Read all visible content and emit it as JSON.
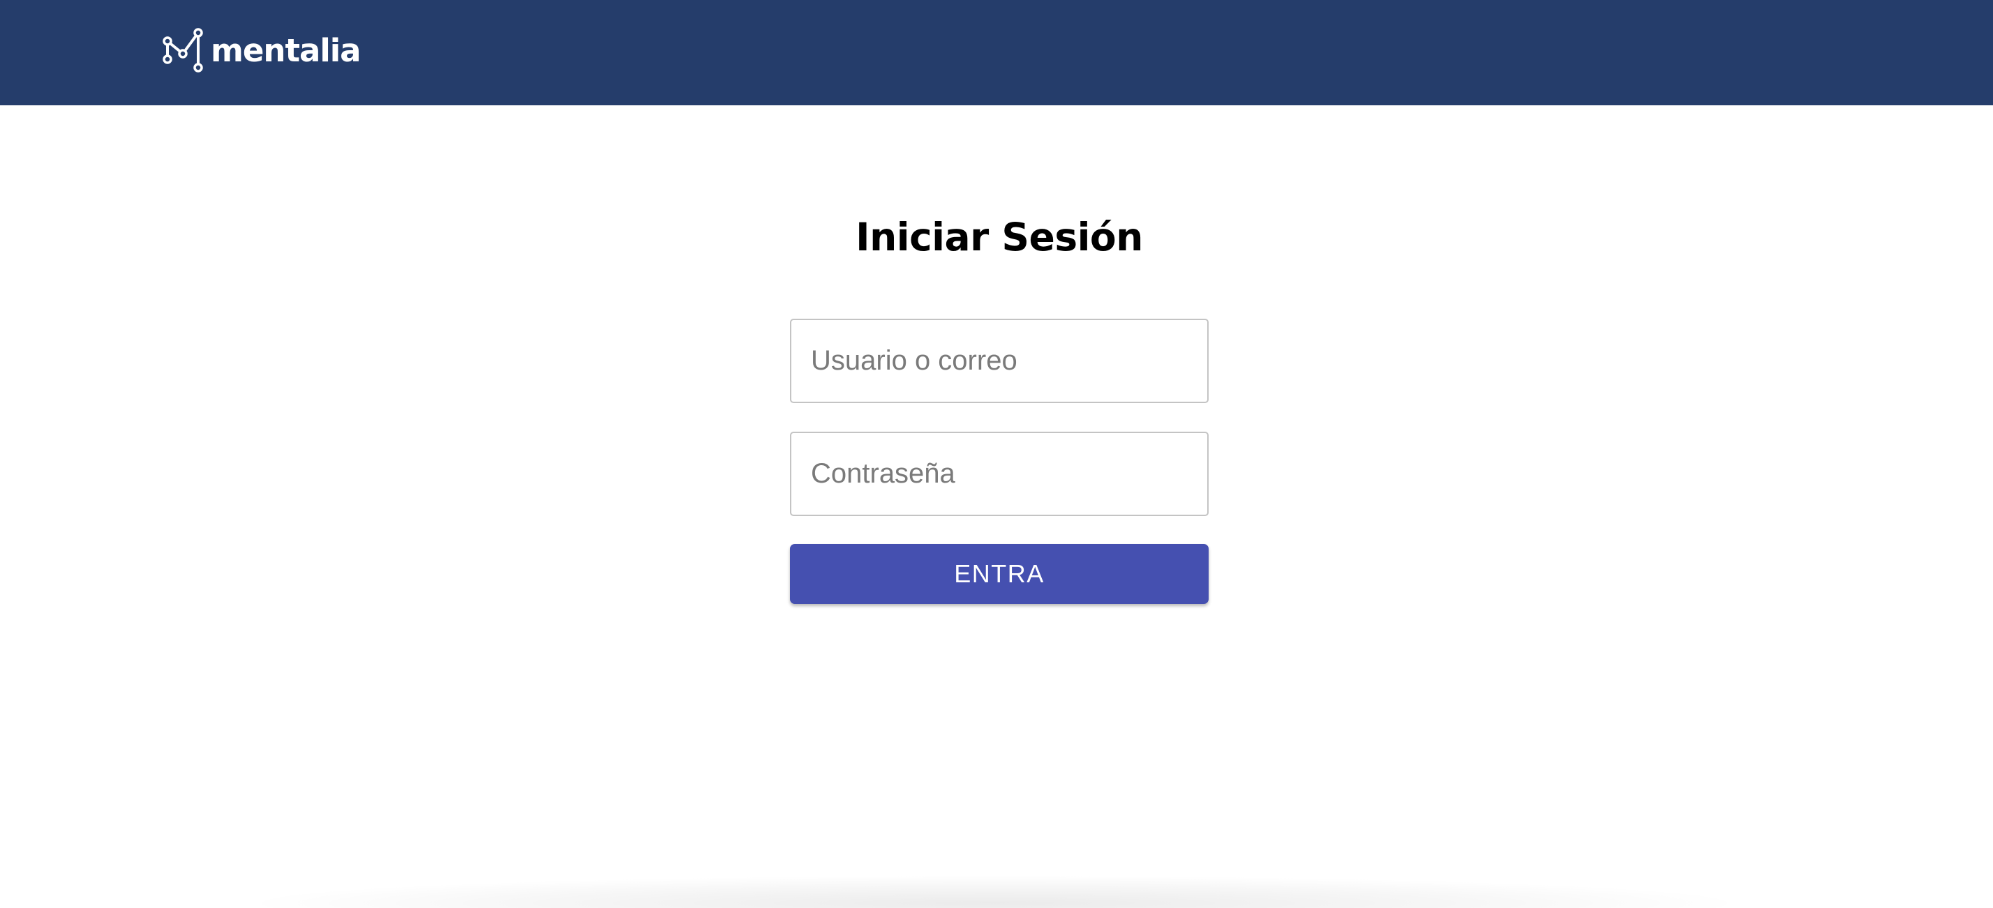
{
  "header": {
    "brand_name": "mentalia",
    "brand_icon": "network-m-logo-icon",
    "background_color": "#253d6b"
  },
  "login": {
    "title": "Iniciar Sesión",
    "username_placeholder": "Usuario o correo",
    "username_value": "",
    "password_placeholder": "Contraseña",
    "password_value": "",
    "submit_label": "ENTRA",
    "submit_color": "#4550b0"
  }
}
